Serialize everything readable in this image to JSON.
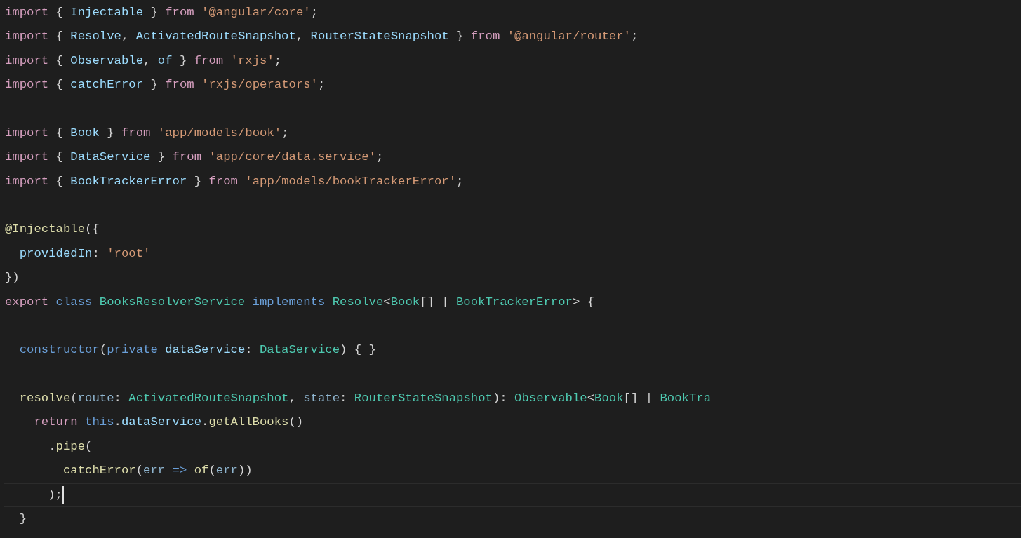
{
  "editor": {
    "lines": [
      {
        "current": false,
        "tokens": [
          {
            "kind": "keyword",
            "text": "import"
          },
          {
            "kind": "punct",
            "text": " { "
          },
          {
            "kind": "variable",
            "text": "Injectable"
          },
          {
            "kind": "punct",
            "text": " } "
          },
          {
            "kind": "keyword",
            "text": "from "
          },
          {
            "kind": "string",
            "text": "'@angular/core'"
          },
          {
            "kind": "punct",
            "text": ";"
          }
        ]
      },
      {
        "current": false,
        "tokens": [
          {
            "kind": "keyword",
            "text": "import"
          },
          {
            "kind": "punct",
            "text": " { "
          },
          {
            "kind": "variable",
            "text": "Resolve"
          },
          {
            "kind": "punct",
            "text": ", "
          },
          {
            "kind": "variable",
            "text": "ActivatedRouteSnapshot"
          },
          {
            "kind": "punct",
            "text": ", "
          },
          {
            "kind": "variable",
            "text": "RouterStateSnapshot"
          },
          {
            "kind": "punct",
            "text": " } "
          },
          {
            "kind": "keyword",
            "text": "from "
          },
          {
            "kind": "string",
            "text": "'@angular/router'"
          },
          {
            "kind": "punct",
            "text": ";"
          }
        ]
      },
      {
        "current": false,
        "tokens": [
          {
            "kind": "keyword",
            "text": "import"
          },
          {
            "kind": "punct",
            "text": " { "
          },
          {
            "kind": "variable",
            "text": "Observable"
          },
          {
            "kind": "punct",
            "text": ", "
          },
          {
            "kind": "variable",
            "text": "of"
          },
          {
            "kind": "punct",
            "text": " } "
          },
          {
            "kind": "keyword",
            "text": "from "
          },
          {
            "kind": "string",
            "text": "'rxjs'"
          },
          {
            "kind": "punct",
            "text": ";"
          }
        ]
      },
      {
        "current": false,
        "tokens": [
          {
            "kind": "keyword",
            "text": "import"
          },
          {
            "kind": "punct",
            "text": " { "
          },
          {
            "kind": "variable",
            "text": "catchError"
          },
          {
            "kind": "punct",
            "text": " } "
          },
          {
            "kind": "keyword",
            "text": "from "
          },
          {
            "kind": "string",
            "text": "'rxjs/operators'"
          },
          {
            "kind": "punct",
            "text": ";"
          }
        ]
      },
      {
        "current": false
      },
      {
        "current": false,
        "tokens": [
          {
            "kind": "keyword",
            "text": "import"
          },
          {
            "kind": "punct",
            "text": " { "
          },
          {
            "kind": "variable",
            "text": "Book"
          },
          {
            "kind": "punct",
            "text": " } "
          },
          {
            "kind": "keyword",
            "text": "from "
          },
          {
            "kind": "string",
            "text": "'app/models/book'"
          },
          {
            "kind": "punct",
            "text": ";"
          }
        ]
      },
      {
        "current": false,
        "tokens": [
          {
            "kind": "keyword",
            "text": "import"
          },
          {
            "kind": "punct",
            "text": " { "
          },
          {
            "kind": "variable",
            "text": "DataService"
          },
          {
            "kind": "punct",
            "text": " } "
          },
          {
            "kind": "keyword",
            "text": "from "
          },
          {
            "kind": "string",
            "text": "'app/core/data.service'"
          },
          {
            "kind": "punct",
            "text": ";"
          }
        ]
      },
      {
        "current": false,
        "tokens": [
          {
            "kind": "keyword",
            "text": "import"
          },
          {
            "kind": "punct",
            "text": " { "
          },
          {
            "kind": "variable",
            "text": "BookTrackerError"
          },
          {
            "kind": "punct",
            "text": " } "
          },
          {
            "kind": "keyword",
            "text": "from "
          },
          {
            "kind": "string",
            "text": "'app/models/bookTrackerError'"
          },
          {
            "kind": "punct",
            "text": ";"
          }
        ]
      },
      {
        "current": false
      },
      {
        "current": false,
        "tokens": [
          {
            "kind": "function",
            "text": "@Injectable"
          },
          {
            "kind": "punct",
            "text": "({"
          }
        ]
      },
      {
        "current": false,
        "tokens": [
          {
            "kind": "variable",
            "text": "  providedIn"
          },
          {
            "kind": "punct",
            "text": ": "
          },
          {
            "kind": "string",
            "text": "'root'"
          }
        ]
      },
      {
        "current": false,
        "tokens": [
          {
            "kind": "punct",
            "text": "})"
          }
        ]
      },
      {
        "current": false,
        "tokens": [
          {
            "kind": "keyword",
            "text": "export "
          },
          {
            "kind": "storage",
            "text": "class "
          },
          {
            "kind": "type",
            "text": "BooksResolverService "
          },
          {
            "kind": "storage",
            "text": "implements "
          },
          {
            "kind": "type",
            "text": "Resolve"
          },
          {
            "kind": "punct",
            "text": "<"
          },
          {
            "kind": "type",
            "text": "Book"
          },
          {
            "kind": "punct",
            "text": "[] | "
          },
          {
            "kind": "type",
            "text": "BookTrackerError"
          },
          {
            "kind": "punct",
            "text": "> {"
          }
        ]
      },
      {
        "current": false
      },
      {
        "current": false,
        "tokens": [
          {
            "kind": "storage",
            "text": "  constructor"
          },
          {
            "kind": "punct",
            "text": "("
          },
          {
            "kind": "storage",
            "text": "private "
          },
          {
            "kind": "variable",
            "text": "dataService"
          },
          {
            "kind": "punct",
            "text": ": "
          },
          {
            "kind": "type",
            "text": "DataService"
          },
          {
            "kind": "punct",
            "text": ") { }"
          }
        ]
      },
      {
        "current": false
      },
      {
        "current": false,
        "tokens": [
          {
            "kind": "function",
            "text": "  resolve"
          },
          {
            "kind": "punct",
            "text": "("
          },
          {
            "kind": "param",
            "text": "route"
          },
          {
            "kind": "punct",
            "text": ": "
          },
          {
            "kind": "type",
            "text": "ActivatedRouteSnapshot"
          },
          {
            "kind": "punct",
            "text": ", "
          },
          {
            "kind": "param",
            "text": "state"
          },
          {
            "kind": "punct",
            "text": ": "
          },
          {
            "kind": "type",
            "text": "RouterStateSnapshot"
          },
          {
            "kind": "punct",
            "text": "): "
          },
          {
            "kind": "type",
            "text": "Observable"
          },
          {
            "kind": "punct",
            "text": "<"
          },
          {
            "kind": "type",
            "text": "Book"
          },
          {
            "kind": "punct",
            "text": "[] | "
          },
          {
            "kind": "type",
            "text": "BookTra"
          }
        ]
      },
      {
        "current": false,
        "tokens": [
          {
            "kind": "keyword",
            "text": "    return "
          },
          {
            "kind": "storage",
            "text": "this"
          },
          {
            "kind": "punct",
            "text": "."
          },
          {
            "kind": "variable",
            "text": "dataService"
          },
          {
            "kind": "punct",
            "text": "."
          },
          {
            "kind": "function",
            "text": "getAllBooks"
          },
          {
            "kind": "punct",
            "text": "()"
          }
        ]
      },
      {
        "current": false,
        "tokens": [
          {
            "kind": "punct",
            "text": "      ."
          },
          {
            "kind": "function",
            "text": "pipe"
          },
          {
            "kind": "punct",
            "text": "("
          }
        ]
      },
      {
        "current": false,
        "tokens": [
          {
            "kind": "function",
            "text": "        catchError"
          },
          {
            "kind": "punct",
            "text": "("
          },
          {
            "kind": "param",
            "text": "err "
          },
          {
            "kind": "storage",
            "text": "=> "
          },
          {
            "kind": "function",
            "text": "of"
          },
          {
            "kind": "punct",
            "text": "("
          },
          {
            "kind": "param",
            "text": "err"
          },
          {
            "kind": "punct",
            "text": "))"
          }
        ]
      },
      {
        "current": true,
        "tokens": [
          {
            "kind": "punct",
            "text": "      );"
          }
        ]
      },
      {
        "current": false,
        "tokens": [
          {
            "kind": "punct",
            "text": "  }"
          }
        ]
      }
    ]
  }
}
